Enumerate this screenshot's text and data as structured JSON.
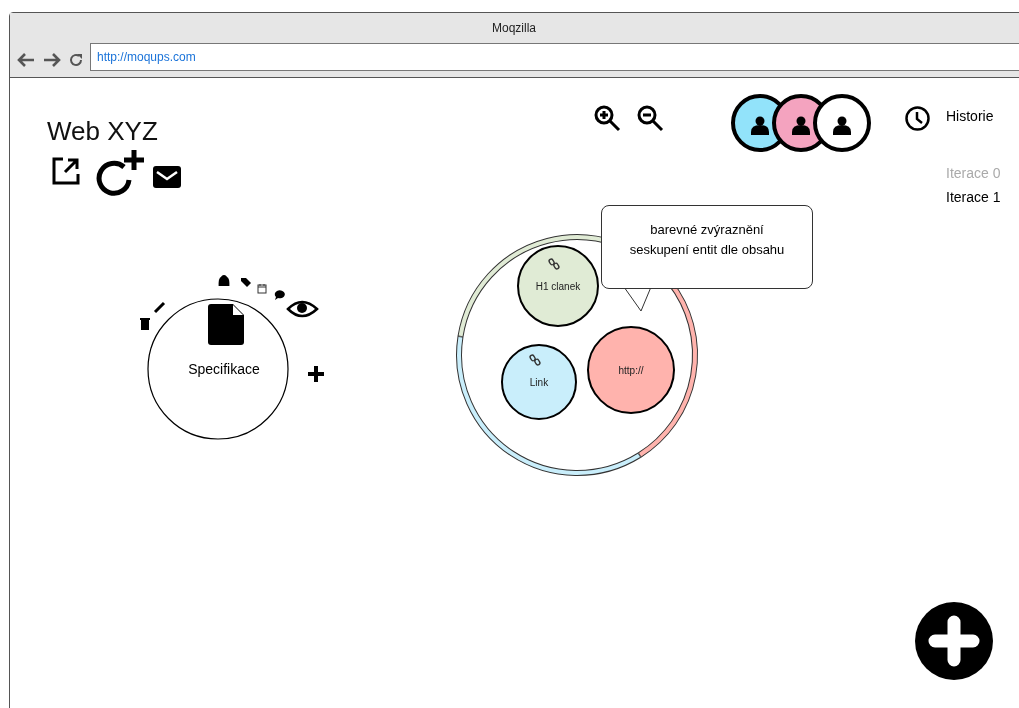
{
  "window": {
    "title": "Moqzilla",
    "url": "http://moqups.com"
  },
  "project": {
    "title": "Web XYZ"
  },
  "users": [
    {
      "color": "#92e3fa"
    },
    {
      "color": "#f4a3bf"
    },
    {
      "color": "#ffffff"
    }
  ],
  "history": {
    "label": "Historie",
    "iterations": [
      {
        "label": "Iterace 0",
        "selected": false
      },
      {
        "label": "Iterace 1",
        "selected": true
      }
    ]
  },
  "entity": {
    "label": "Specifikace"
  },
  "cluster": {
    "nodes": [
      {
        "label": "H1 clanek",
        "color": "#e0ebd5",
        "linked": true
      },
      {
        "label": "Link",
        "color": "#c9eefb",
        "linked": true
      },
      {
        "label": "http://",
        "color": "#ffb3ad",
        "linked": false
      }
    ]
  },
  "tooltip": {
    "text": "barevné zvýraznění\nseskupení entit dle obsahu"
  }
}
